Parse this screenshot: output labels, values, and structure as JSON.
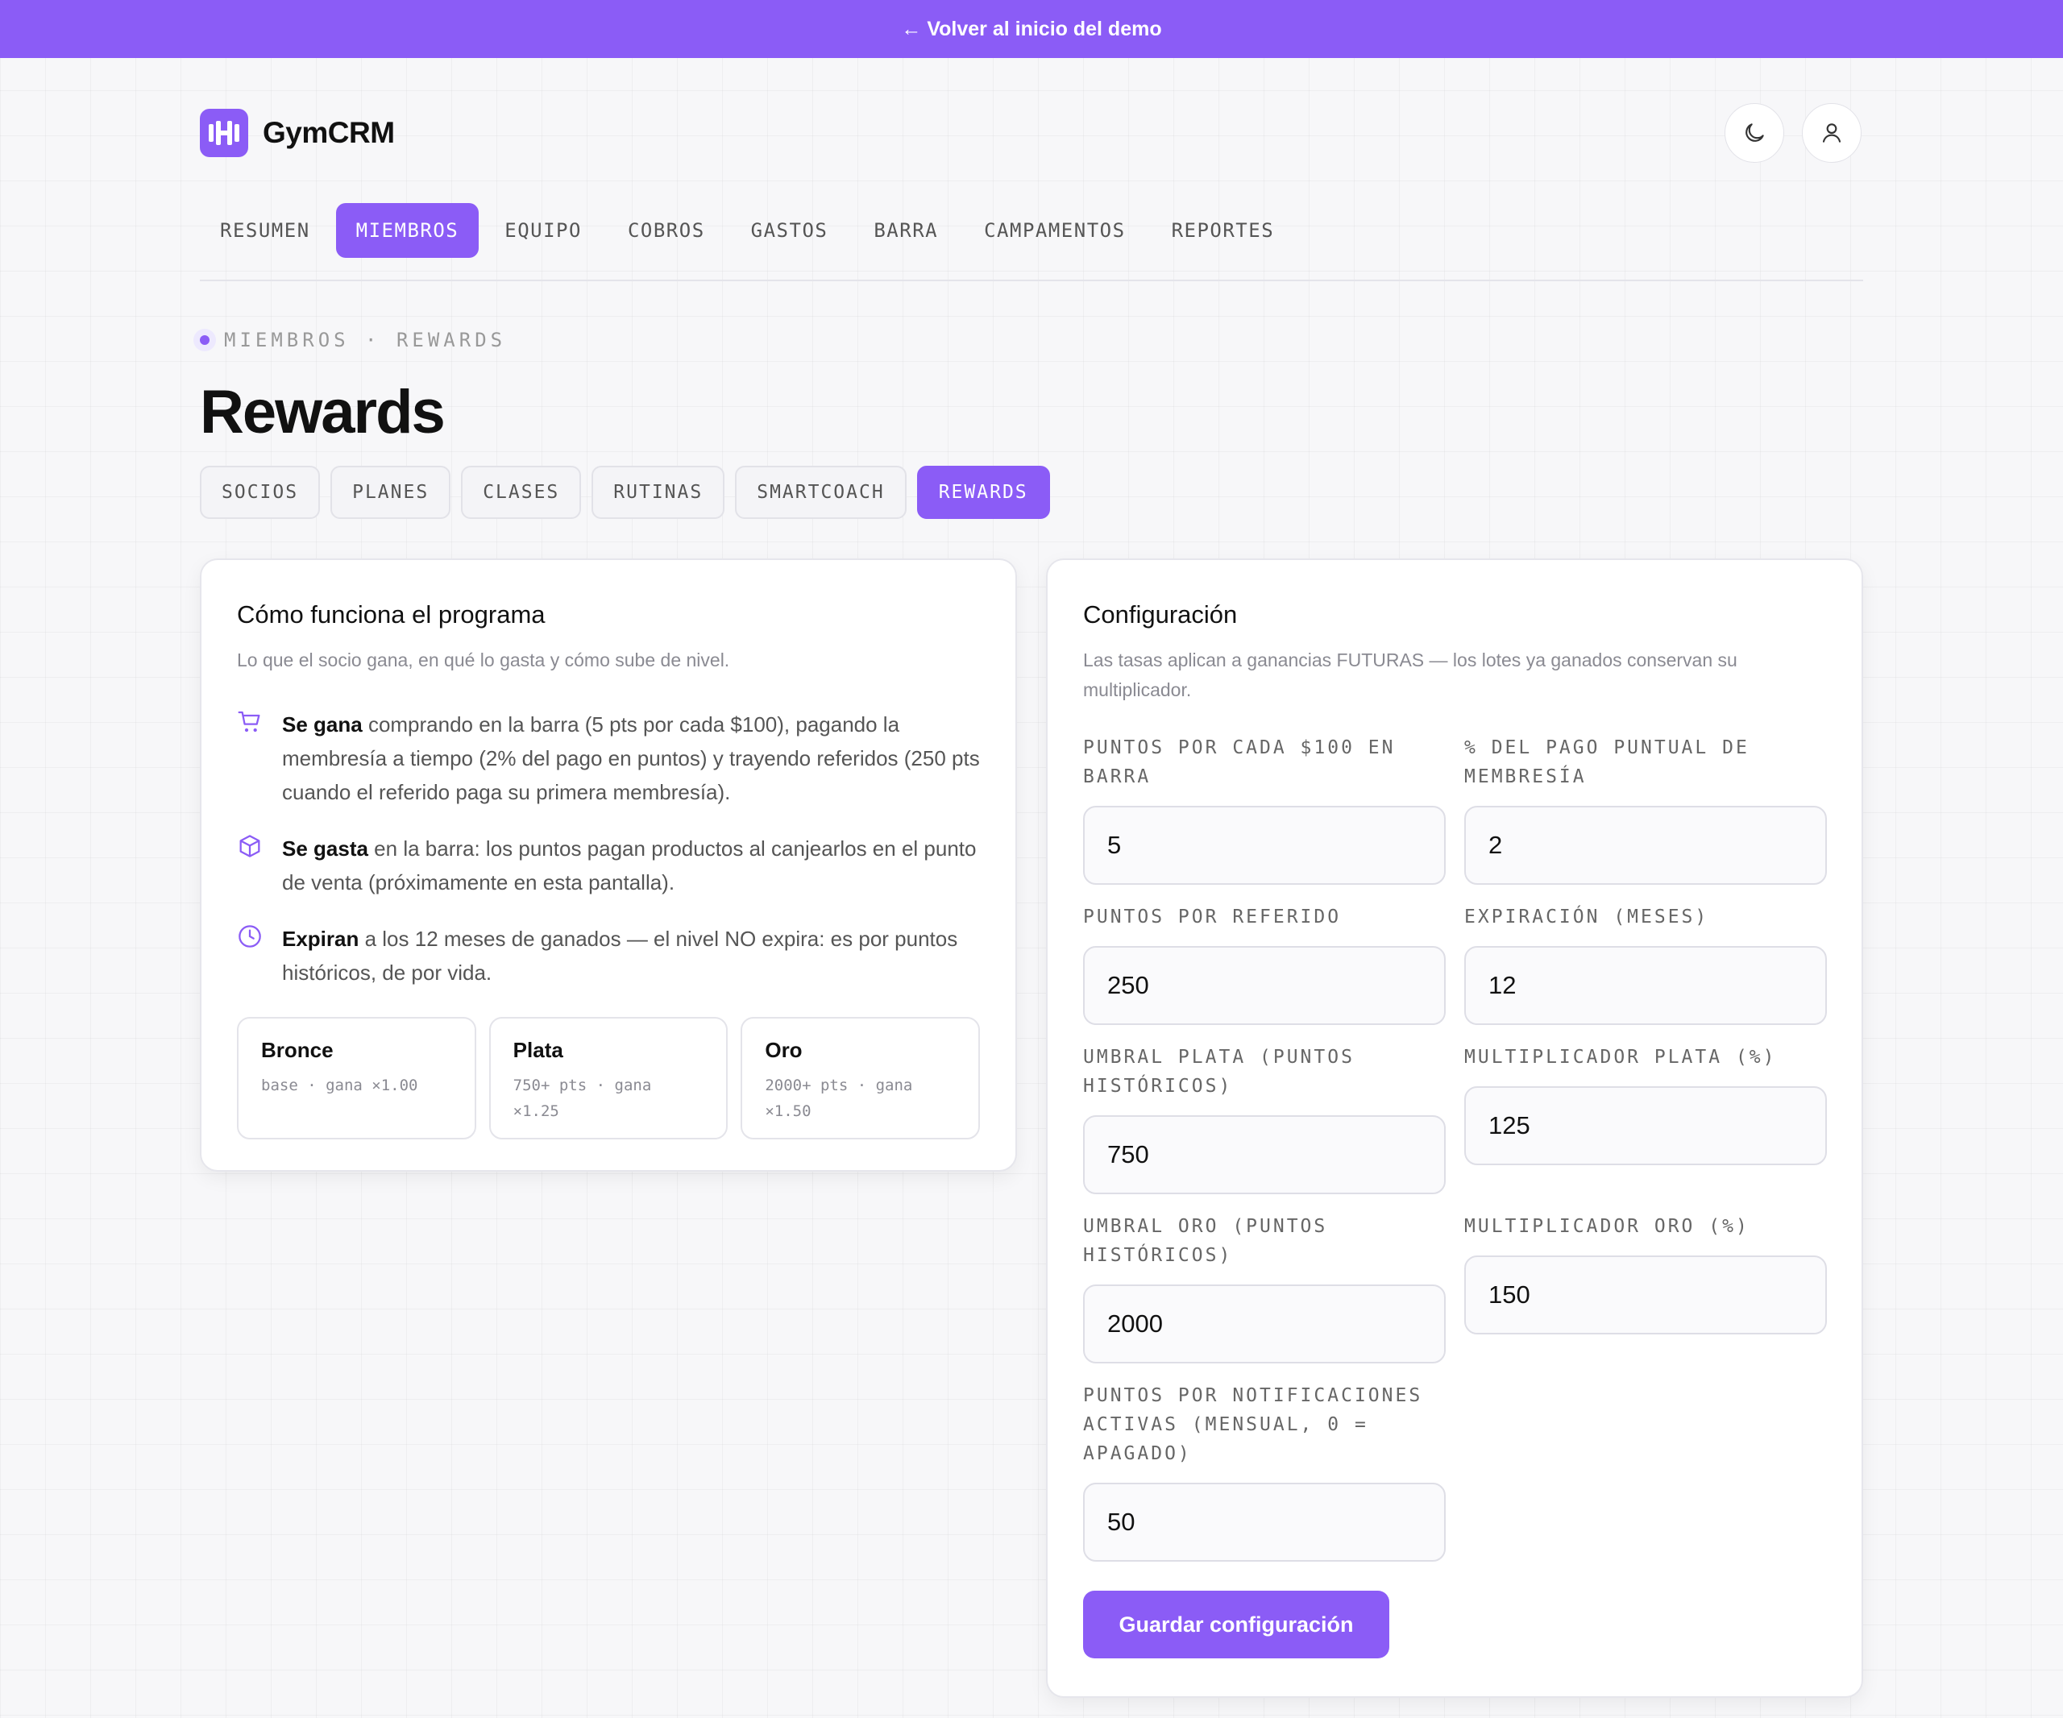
{
  "banner": {
    "label": "← Volver al inicio del demo"
  },
  "brand": {
    "name": "GymCRM",
    "accent": "#8b5cf6"
  },
  "header_icons": [
    "moon-icon",
    "user-icon"
  ],
  "nav": {
    "items": [
      "RESUMEN",
      "MIEMBROS",
      "EQUIPO",
      "COBROS",
      "GASTOS",
      "BARRA",
      "CAMPAMENTOS",
      "REPORTES"
    ],
    "active": "MIEMBROS"
  },
  "breadcrumb": "MIEMBROS · REWARDS",
  "page_title": "Rewards",
  "subtabs": {
    "items": [
      "SOCIOS",
      "PLANES",
      "CLASES",
      "RUTINAS",
      "SMARTCOACH",
      "REWARDS"
    ],
    "active": "REWARDS"
  },
  "how": {
    "title": "Cómo funciona el programa",
    "subtitle": "Lo que el socio gana, en qué lo gasta y cómo sube de nivel.",
    "rules": [
      {
        "icon": "cart-icon",
        "bold": "Se gana",
        "text": " comprando en la barra (5 pts por cada $100), pagando la membresía a tiempo (2% del pago en puntos) y trayendo referidos (250 pts cuando el referido paga su primera membresía)."
      },
      {
        "icon": "box-icon",
        "bold": "Se gasta",
        "text": " en la barra: los puntos pagan productos al canjearlos en el punto de venta (próximamente en esta pantalla)."
      },
      {
        "icon": "clock-icon",
        "bold": "Expiran",
        "text": " a los 12 meses de ganados — el nivel NO expira: es por puntos históricos, de por vida."
      }
    ],
    "tiers": [
      {
        "name": "Bronce",
        "desc": "base · gana ×1.00"
      },
      {
        "name": "Plata",
        "desc": "750+ pts · gana ×1.25"
      },
      {
        "name": "Oro",
        "desc": "2000+ pts · gana ×1.50"
      }
    ]
  },
  "config": {
    "title": "Configuración",
    "subtitle": "Las tasas aplican a ganancias FUTURAS — los lotes ya ganados conservan su multiplicador.",
    "fields": {
      "bar_points": {
        "label": "PUNTOS POR CADA $100 EN BARRA",
        "value": "5"
      },
      "on_time_pct": {
        "label": "% DEL PAGO PUNTUAL DE MEMBRESÍA",
        "value": "2"
      },
      "referral_points": {
        "label": "PUNTOS POR REFERIDO",
        "value": "250"
      },
      "expiration": {
        "label": "EXPIRACIÓN (MESES)",
        "value": "12"
      },
      "silver_threshold": {
        "label": "UMBRAL PLATA (PUNTOS HISTÓRICOS)",
        "value": "750"
      },
      "silver_multiplier": {
        "label": "MULTIPLICADOR PLATA (%)",
        "value": "125"
      },
      "gold_threshold": {
        "label": "UMBRAL ORO (PUNTOS HISTÓRICOS)",
        "value": "2000"
      },
      "gold_multiplier": {
        "label": "MULTIPLICADOR ORO (%)",
        "value": "150"
      },
      "notif_points": {
        "label": "PUNTOS POR NOTIFICACIONES ACTIVAS (MENSUAL, 0 = APAGADO)",
        "value": "50"
      }
    },
    "save_label": "Guardar configuración"
  }
}
